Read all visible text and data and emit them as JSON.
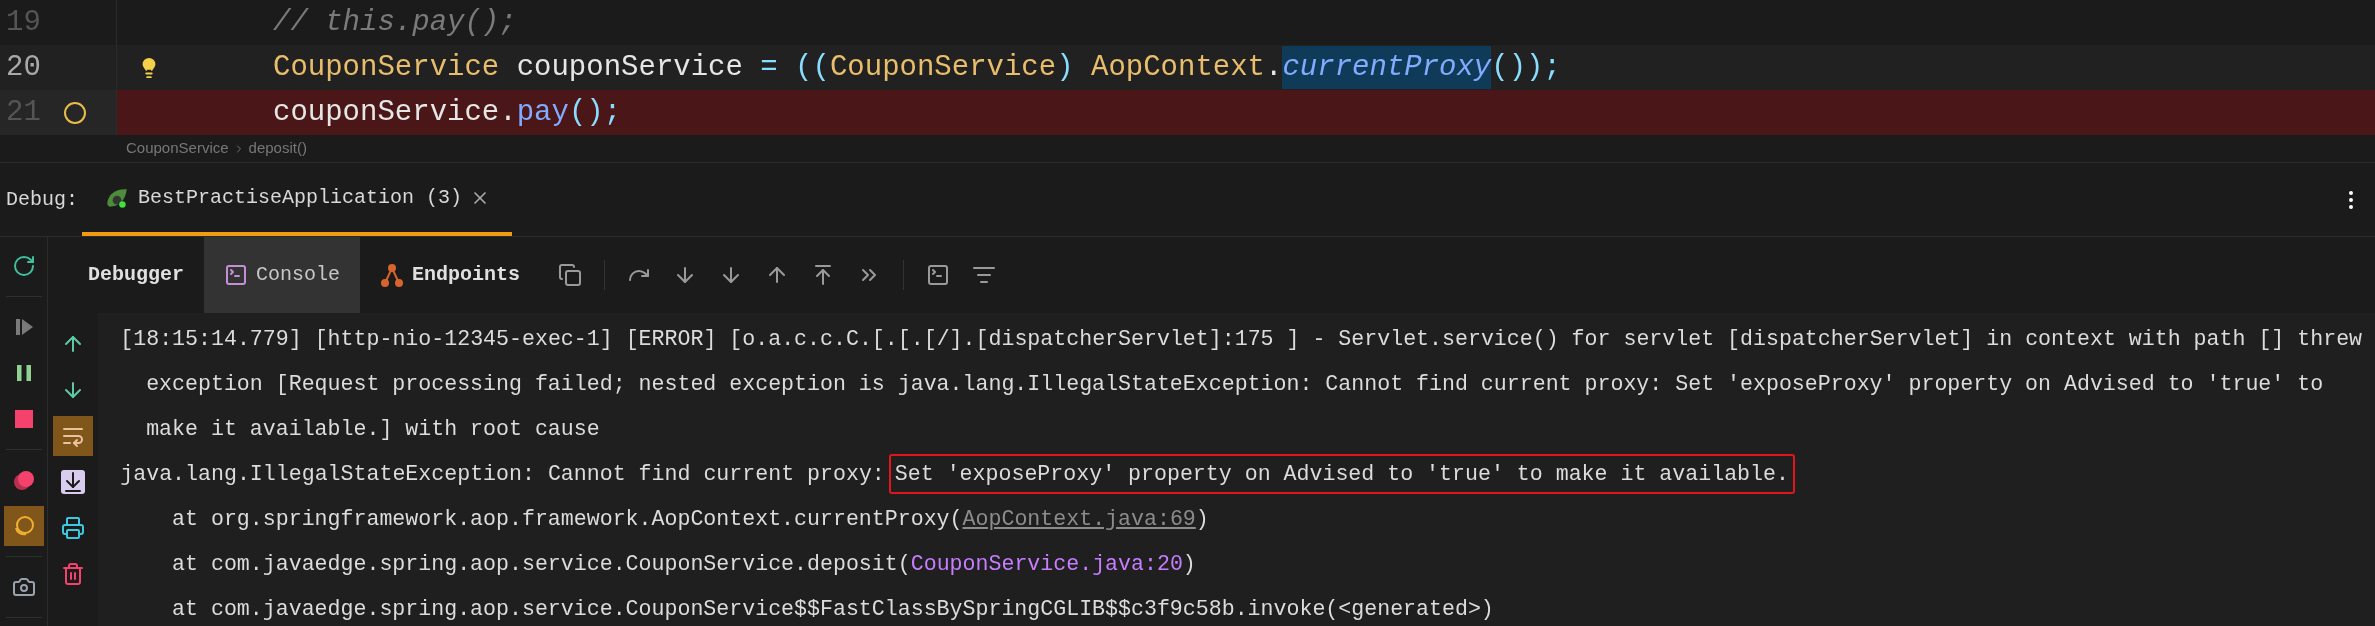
{
  "editor": {
    "lines": [
      {
        "number": "19",
        "current": false,
        "breakpoint_hit": false,
        "kind": "none",
        "tokens": [
          {
            "text": "// this.pay();",
            "kind": "comment",
            "selected": false
          }
        ]
      },
      {
        "number": "20",
        "current": true,
        "breakpoint_hit": false,
        "kind": "bulb",
        "tokens": [
          {
            "text": "CouponService",
            "kind": "type",
            "selected": false
          },
          {
            "text": " couponService ",
            "kind": "ident",
            "selected": false
          },
          {
            "text": "=",
            "kind": "op",
            "selected": false
          },
          {
            "text": " ((",
            "kind": "op",
            "selected": false
          },
          {
            "text": "CouponService",
            "kind": "type",
            "selected": false
          },
          {
            "text": ")",
            "kind": "op",
            "selected": false
          },
          {
            "text": " AopContext",
            "kind": "type",
            "selected": false
          },
          {
            "text": ".",
            "kind": "ident",
            "selected": false
          },
          {
            "text": "currentProxy",
            "kind": "static_method",
            "selected": true
          },
          {
            "text": "());",
            "kind": "op",
            "selected": false
          }
        ]
      },
      {
        "number": "21",
        "current": false,
        "breakpoint_hit": true,
        "kind": "breakpoint",
        "tokens": [
          {
            "text": "couponService",
            "kind": "ident",
            "selected": false
          },
          {
            "text": ".",
            "kind": "ident",
            "selected": false
          },
          {
            "text": "pay",
            "kind": "method",
            "selected": false
          },
          {
            "text": "();",
            "kind": "op",
            "selected": false
          }
        ]
      }
    ],
    "breadcrumb": [
      "CouponService",
      "deposit()"
    ]
  },
  "debug_bar": {
    "label": "Debug:",
    "sessions": [
      {
        "label": "BestPractiseApplication (3)",
        "selected": true
      }
    ]
  },
  "tabs": [
    {
      "label": "Debugger",
      "kind": "debugger",
      "selected": false
    },
    {
      "label": "Console",
      "kind": "console",
      "selected": true
    },
    {
      "label": "Endpoints",
      "kind": "endpoints",
      "selected": false
    }
  ],
  "debug_actions": [
    {
      "kind": "rerun",
      "on": false
    },
    {
      "kind": "divider"
    },
    {
      "kind": "resume",
      "on": false
    },
    {
      "kind": "pause",
      "on": false
    },
    {
      "kind": "stop",
      "on": false
    },
    {
      "kind": "divider"
    },
    {
      "kind": "breakpoints",
      "on": false
    },
    {
      "kind": "mute",
      "on": true
    },
    {
      "kind": "divider"
    },
    {
      "kind": "camera",
      "on": false
    },
    {
      "kind": "divider"
    }
  ],
  "console_actions": [
    {
      "kind": "up",
      "on": false
    },
    {
      "kind": "down",
      "on": false
    },
    {
      "kind": "wrap",
      "on": true
    },
    {
      "kind": "scroll_end",
      "on": false
    },
    {
      "kind": "print",
      "on": false
    },
    {
      "kind": "clear",
      "on": false
    }
  ],
  "console": [
    {
      "kind": "log",
      "text": "[18:15:14.779] [http-nio-12345-exec-1] [ERROR] [o.a.c.c.C.[.[.[/].[dispatcherServlet]:175 ] - Servlet.service() for servlet [dispatcherServlet] in context with path [] threw exception [Request processing failed; nested exception is java.lang.IllegalStateException: Cannot find current proxy: Set 'exposeProxy' property on Advised to 'true' to make it available.] with root cause"
    },
    {
      "kind": "error",
      "text": "java.lang.IllegalStateException: Cannot find current proxy:",
      "boxed": "Set 'exposeProxy' property on Advised to 'true' to make it available."
    },
    {
      "kind": "frame",
      "text": "at org.springframework.aop.framework.AopContext.currentProxy(",
      "link": {
        "text": "AopContext.java:69",
        "kind": "library"
      },
      "suffix": ")"
    },
    {
      "kind": "frame",
      "text": "at com.javaedge.spring.aop.service.CouponService.deposit(",
      "link": {
        "text": "CouponService.java:20",
        "kind": "project"
      },
      "suffix": ")"
    },
    {
      "kind": "frame",
      "text": "at com.javaedge.spring.aop.service.CouponService$$FastClassBySpringCGLIB$$c3f9c58b.invoke(<generated>)"
    }
  ]
}
